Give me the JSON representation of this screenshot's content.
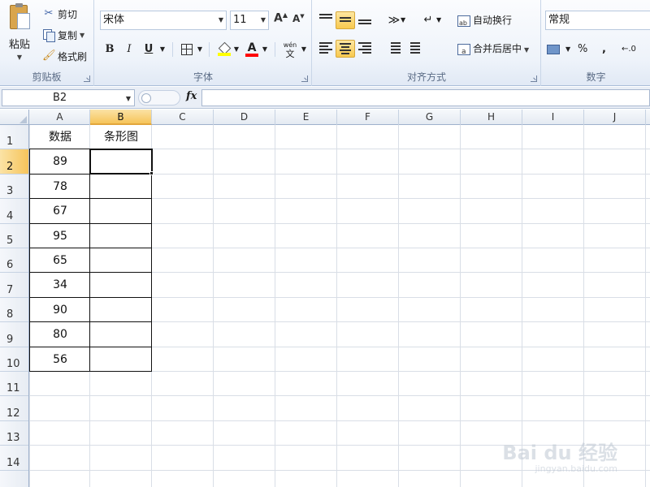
{
  "ribbon": {
    "clipboard": {
      "label": "剪贴板",
      "paste": "粘贴",
      "cut": "剪切",
      "copy": "复制",
      "format_painter": "格式刷"
    },
    "font": {
      "label": "字体",
      "font_name": "宋体",
      "font_size": "11",
      "bold": "B",
      "italic": "I",
      "underline": "U",
      "phonetic": "wén"
    },
    "alignment": {
      "label": "对齐方式",
      "wrap_text": "自动换行",
      "merge_center": "合并后居中"
    },
    "number": {
      "label": "数字",
      "format": "常规",
      "percent": "%",
      "comma": ","
    },
    "colors": {
      "fill": "#ffff00",
      "font_color": "#ff0000"
    }
  },
  "formula_bar": {
    "name_box": "B2",
    "fx": "fx",
    "formula": ""
  },
  "sheet": {
    "columns": [
      "A",
      "B",
      "C",
      "D",
      "E",
      "F",
      "G",
      "H",
      "I",
      "J"
    ],
    "rows": [
      "1",
      "2",
      "3",
      "4",
      "5",
      "6",
      "7",
      "8",
      "9",
      "10",
      "11",
      "12",
      "13",
      "14"
    ],
    "selected_column": "B",
    "selected_row": "2",
    "header_a": "数据",
    "header_b": "条形图",
    "values": [
      "89",
      "78",
      "67",
      "95",
      "65",
      "34",
      "90",
      "80",
      "56"
    ]
  },
  "watermark": {
    "brand": "Bai du 经验",
    "url": "jingyan.baidu.com"
  }
}
